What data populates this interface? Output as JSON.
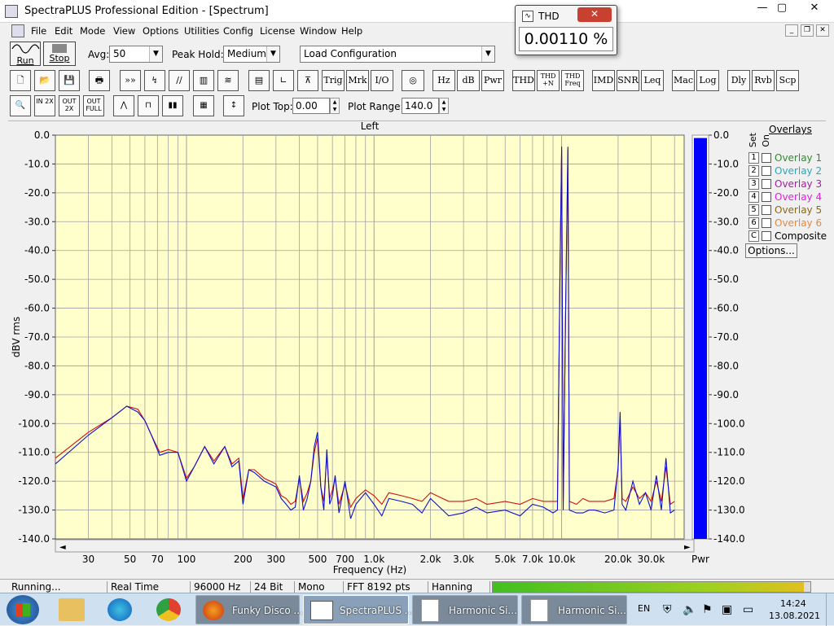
{
  "window": {
    "title": "SpectraPLUS Professional Edition - [Spectrum]",
    "minimize": "—",
    "maximize": "▢",
    "close": "✕"
  },
  "menu": [
    "File",
    "Edit",
    "Mode",
    "View",
    "Options",
    "Utilities",
    "Config",
    "License",
    "Window",
    "Help"
  ],
  "toolbar": {
    "run_label": "Run",
    "stop_label": "Stop",
    "avg_label": "Avg:",
    "avg_value": "50",
    "peak_hold_label": "Peak Hold:",
    "peak_hold_value": "Medium",
    "load_config": "Load Configuration",
    "buttons": [
      "Trig",
      "Mrk",
      "I/O",
      "Hz",
      "dB",
      "Pwr",
      "THD",
      "THD+N",
      "THD Freq",
      "IMD",
      "SNR",
      "Leq",
      "Mac",
      "Log",
      "Dly",
      "Rvb",
      "Scp"
    ],
    "thdn_label": "THD +N",
    "thdfreq_label": "THD Freq",
    "zoom_in": "IN 2X",
    "zoom_out": "OUT 2X",
    "zoom_full": "OUT FULL",
    "plot_top_label": "Plot Top:",
    "plot_top_value": "0.00",
    "plot_range_label": "Plot Range:",
    "plot_range_value": "140.0"
  },
  "thd": {
    "title": "THD",
    "value": "0.00110 %"
  },
  "chart_data": {
    "type": "line",
    "title": "Left",
    "xlabel": "Frequency (Hz)",
    "ylabel": "dBV rms",
    "xscale": "log",
    "xlim": [
      20,
      45000
    ],
    "ylim": [
      -140,
      0
    ],
    "yticks": [
      "0.0",
      "-10.0",
      "-20.0",
      "-30.0",
      "-40.0",
      "-50.0",
      "-60.0",
      "-70.0",
      "-80.0",
      "-90.0",
      "-100.0",
      "-110.0",
      "-120.0",
      "-130.0",
      "-140.0"
    ],
    "xticks": [
      {
        "v": 30,
        "label": "30"
      },
      {
        "v": 50,
        "label": "50"
      },
      {
        "v": 70,
        "label": "70"
      },
      {
        "v": 100,
        "label": "100"
      },
      {
        "v": 200,
        "label": "200"
      },
      {
        "v": 300,
        "label": "300"
      },
      {
        "v": 500,
        "label": "500"
      },
      {
        "v": 700,
        "label": "700"
      },
      {
        "v": 1000,
        "label": "1.0k"
      },
      {
        "v": 2000,
        "label": "2.0k"
      },
      {
        "v": 3000,
        "label": "3.0k"
      },
      {
        "v": 5000,
        "label": "5.0k"
      },
      {
        "v": 7000,
        "label": "7.0k"
      },
      {
        "v": 10000,
        "label": "10.0k"
      },
      {
        "v": 20000,
        "label": "20.0k"
      },
      {
        "v": 30000,
        "label": "30.0k"
      }
    ],
    "grid": true,
    "series": [
      {
        "color": "#1010d0",
        "x": [
          20,
          30,
          40,
          48,
          55,
          60,
          65,
          72,
          80,
          90,
          100,
          110,
          125,
          140,
          160,
          175,
          190,
          200,
          215,
          230,
          260,
          280,
          300,
          320,
          340,
          360,
          380,
          400,
          420,
          440,
          460,
          480,
          500,
          520,
          540,
          560,
          580,
          600,
          620,
          650,
          700,
          750,
          800,
          900,
          1000,
          1100,
          1200,
          1400,
          1600,
          1800,
          2000,
          2500,
          3000,
          3500,
          4000,
          5000,
          6000,
          7000,
          8000,
          9000,
          9500,
          9800,
          10000,
          10200,
          10500,
          10800,
          11000,
          12000,
          13000,
          14000,
          15000,
          17000,
          19000,
          20000,
          20500,
          21000,
          22000,
          24000,
          26000,
          28000,
          30000,
          32000,
          34000,
          36000,
          38000,
          40000
        ],
        "y": [
          -114,
          -104,
          -98,
          -94,
          -96,
          -99,
          -104,
          -111,
          -110,
          -110,
          -120,
          -115,
          -108,
          -114,
          -108,
          -115,
          -113,
          -128,
          -116,
          -117,
          -120,
          -121,
          -122,
          -126,
          -128,
          -130,
          -129,
          -118,
          -130,
          -126,
          -120,
          -108,
          -103,
          -122,
          -130,
          -109,
          -128,
          -125,
          -118,
          -131,
          -120,
          -133,
          -128,
          -124,
          -128,
          -132,
          -126,
          -127,
          -128,
          -131,
          -126,
          -132,
          -131,
          -129,
          -131,
          -130,
          -132,
          -128,
          -129,
          -131,
          -130,
          -49,
          -4,
          -130,
          -62,
          -4,
          -130,
          -131,
          -131,
          -130,
          -130,
          -131,
          -130,
          -115,
          -96,
          -128,
          -130,
          -120,
          -128,
          -124,
          -130,
          -118,
          -130,
          -112,
          -131,
          -130
        ]
      },
      {
        "color": "#d01010",
        "x": [
          20,
          30,
          40,
          48,
          55,
          60,
          65,
          72,
          80,
          90,
          100,
          110,
          125,
          140,
          160,
          175,
          190,
          200,
          215,
          230,
          260,
          280,
          300,
          320,
          340,
          360,
          380,
          400,
          420,
          440,
          460,
          480,
          500,
          520,
          540,
          560,
          580,
          600,
          620,
          650,
          700,
          750,
          800,
          900,
          1000,
          1100,
          1200,
          1400,
          1600,
          1800,
          2000,
          2500,
          3000,
          3500,
          4000,
          5000,
          6000,
          7000,
          8000,
          9000,
          9500,
          9800,
          10000,
          10200,
          10500,
          10800,
          11000,
          12000,
          13000,
          14000,
          15000,
          17000,
          19000,
          20000,
          20500,
          21000,
          22000,
          24000,
          26000,
          28000,
          30000,
          32000,
          34000,
          36000,
          38000,
          40000
        ],
        "y": [
          -112,
          -103,
          -98,
          -94,
          -95,
          -99,
          -104,
          -110,
          -109,
          -110,
          -119,
          -115,
          -108,
          -113,
          -108,
          -114,
          -112,
          -126,
          -116,
          -116,
          -119,
          -120,
          -121,
          -125,
          -126,
          -128,
          -127,
          -119,
          -127,
          -124,
          -120,
          -110,
          -105,
          -122,
          -127,
          -111,
          -126,
          -123,
          -119,
          -128,
          -121,
          -129,
          -126,
          -123,
          -125,
          -128,
          -124,
          -125,
          -126,
          -127,
          -124,
          -127,
          -127,
          -126,
          -128,
          -127,
          -128,
          -126,
          -127,
          -127,
          -127,
          -50,
          -5,
          -127,
          -63,
          -5,
          -127,
          -128,
          -126,
          -127,
          -127,
          -127,
          -126,
          -116,
          -98,
          -126,
          -127,
          -122,
          -126,
          -124,
          -127,
          -120,
          -127,
          -115,
          -128,
          -127
        ]
      }
    ]
  },
  "power_bar": {
    "value_db": -1.0,
    "label": "Pwr",
    "color": "#0000ff"
  },
  "overlays": {
    "header": "Overlays",
    "set_label": "Set",
    "on_label": "On",
    "items": [
      {
        "num": "1",
        "label": "Overlay 1",
        "color": "#2e8b2e"
      },
      {
        "num": "2",
        "label": "Overlay 2",
        "color": "#2aa8b8"
      },
      {
        "num": "3",
        "label": "Overlay 3",
        "color": "#a020a0"
      },
      {
        "num": "4",
        "label": "Overlay 4",
        "color": "#e020e0"
      },
      {
        "num": "5",
        "label": "Overlay 5",
        "color": "#8a6a10"
      },
      {
        "num": "6",
        "label": "Overlay 6",
        "color": "#e08a40"
      },
      {
        "num": "C",
        "label": "Composite",
        "color": "#000000"
      }
    ],
    "options_button": "Options..."
  },
  "status": {
    "state": "Running...",
    "mode": "Real Time",
    "rate": "96000 Hz",
    "bits": "24 Bit",
    "channels": "Mono",
    "fft": "FFT 8192 pts",
    "window": "Hanning",
    "level_fraction": 0.98
  },
  "taskbar": {
    "items": [
      "Funky Disco ...",
      "SpectraPLUS ...",
      "Harmonic Si...",
      "Harmonic Si..."
    ],
    "lang": "EN",
    "time": "14:24",
    "date": "13.08.2021"
  },
  "colors": {
    "plot_bg": "#ffffcc",
    "grid": "#a0a0a0",
    "accent": "#0000ff"
  }
}
